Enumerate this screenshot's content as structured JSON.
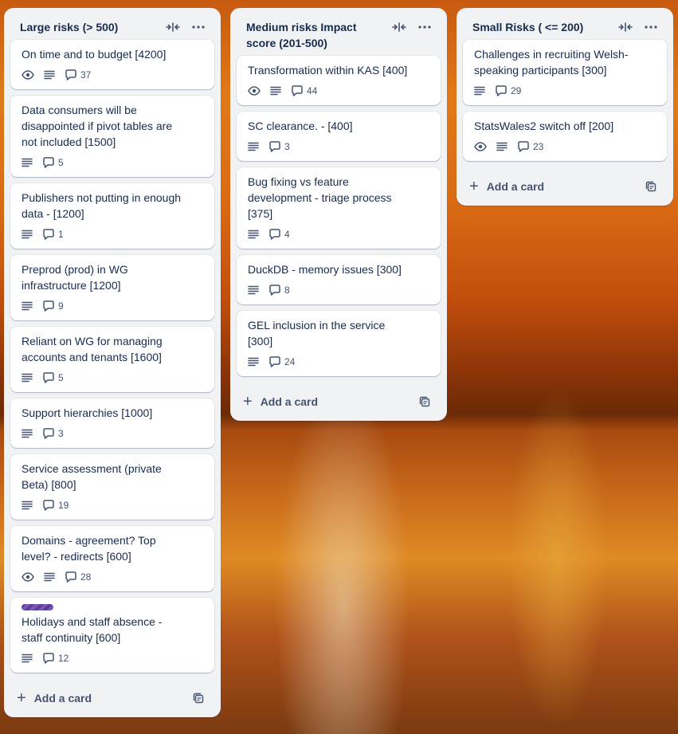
{
  "lists": [
    {
      "title": "Large risks (> 500)",
      "add_card_label": "Add a card",
      "cards": [
        {
          "title": "On time and to budget [4200]",
          "watch": true,
          "desc": true,
          "comments": "37"
        },
        {
          "title": "Data consumers will be disappointed if pivot tables are not included [1500]",
          "watch": false,
          "desc": true,
          "comments": "5"
        },
        {
          "title": "Publishers not putting in enough data - [1200]",
          "watch": false,
          "desc": true,
          "comments": "1"
        },
        {
          "title": "Preprod (prod) in WG infrastructure [1200]",
          "watch": false,
          "desc": true,
          "comments": "9"
        },
        {
          "title": "Reliant on WG for managing accounts and tenants [1600]",
          "watch": false,
          "desc": true,
          "comments": "5"
        },
        {
          "title": "Support hierarchies [1000]",
          "watch": false,
          "desc": true,
          "comments": "3"
        },
        {
          "title": "Service assessment (private Beta) [800]",
          "watch": false,
          "desc": true,
          "comments": "19"
        },
        {
          "title": "Domains - agreement? Top level? - redirects [600]",
          "watch": true,
          "desc": true,
          "comments": "28"
        },
        {
          "title": "Holidays and staff absence - staff continuity [600]",
          "watch": false,
          "desc": true,
          "comments": "12",
          "label": true
        }
      ]
    },
    {
      "title": "Medium risks Impact score (201-500)",
      "add_card_label": "Add a card",
      "cards": [
        {
          "title": "Transformation within KAS [400]",
          "watch": true,
          "desc": true,
          "comments": "44"
        },
        {
          "title": "SC clearance. - [400]",
          "watch": false,
          "desc": true,
          "comments": "3"
        },
        {
          "title": "Bug fixing vs feature development - triage process [375]",
          "watch": false,
          "desc": true,
          "comments": "4"
        },
        {
          "title": "DuckDB - memory issues [300]",
          "watch": false,
          "desc": true,
          "comments": "8"
        },
        {
          "title": "GEL inclusion in the service [300]",
          "watch": false,
          "desc": true,
          "comments": "24"
        }
      ]
    },
    {
      "title": "Small Risks ( <= 200)",
      "add_card_label": "Add a card",
      "cards": [
        {
          "title": "Challenges in recruiting Welsh-speaking participants [300]",
          "watch": false,
          "desc": true,
          "comments": "29"
        },
        {
          "title": "StatsWales2 switch off [200]",
          "watch": true,
          "desc": true,
          "comments": "23"
        }
      ]
    }
  ],
  "icons": {
    "collapse": "collapse-icon",
    "menu": "more-horizontal-icon",
    "watch": "eye-icon",
    "description": "description-icon",
    "comments": "comment-icon",
    "add": "plus-icon",
    "template": "card-template-icon"
  },
  "colors": {
    "list_bg": "#f1f2f4",
    "card_bg": "#ffffff",
    "text": "#172b4d",
    "subtle_text": "#44546f",
    "label": "#5e3c99"
  }
}
